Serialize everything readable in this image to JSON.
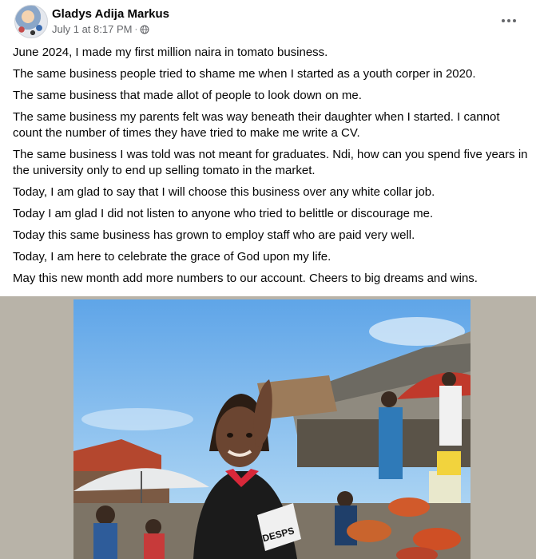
{
  "post": {
    "author": "Gladys Adija Markus",
    "timestamp": "July 1 at 8:17 PM",
    "separator": "·",
    "privacy_icon": "globe-icon",
    "more_icon": "more-horizontal-icon",
    "paragraphs": [
      "June 2024, I made my first million naira in tomato business.",
      "The same business people tried to shame me when I started as a youth corper in 2020.",
      "The same business that made allot of people to look down on me.",
      "The same business my parents felt was way beneath their daughter when I started. I cannot count the number of times they have tried to make me write a CV.",
      "The same business I was told was not meant for graduates. Ndi, how can you spend five years in the university only to end up selling tomato in the market.",
      "Today, I am glad to say that I will choose this business over any white collar job.",
      "Today I am glad I did not listen to anyone who tried to belittle or discourage me.",
      "Today this same business has grown to employ staff who are paid very well.",
      "Today, I am here to celebrate the grace of God upon my life.",
      "May this new month add more numbers to our account. Cheers to big dreams and wins."
    ],
    "photo": {
      "shirt_text": "DESPS"
    }
  }
}
